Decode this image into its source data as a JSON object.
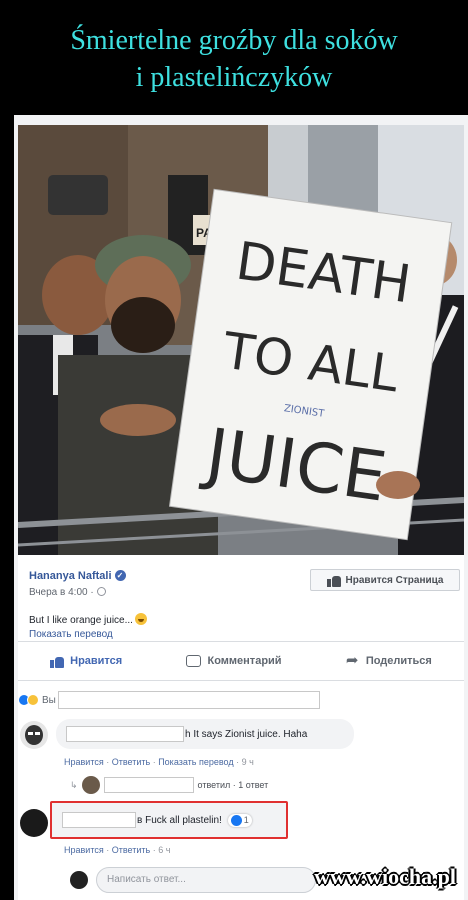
{
  "meme": {
    "title_line1": "Śmiertelne groźby dla soków",
    "title_line2": "i plastelińczyków",
    "watermark": "www.wiocha.pl"
  },
  "photo": {
    "sign_line1": "DEATH",
    "sign_line2": "TO ALL",
    "sign_line3": "JUICE",
    "sign_small": "ZIONIST",
    "bg_sign_fragment": "PAL"
  },
  "post": {
    "author": "Hananya Naftali",
    "time": "Вчера в 4:00 ·",
    "like_page_label": "Нравится Страница",
    "text": "But I like orange juice...",
    "translate": "Показать перевод"
  },
  "actions": {
    "like": "Нравится",
    "comment": "Комментарий",
    "share": "Поделиться"
  },
  "comments": {
    "reactions_text": "Вы",
    "c1_text": "h It says Zionist juice. Haha",
    "c1_meta_like": "Нравится",
    "c1_meta_reply": "Ответить",
    "c1_meta_translate": "Показать перевод",
    "c1_meta_time": "9 ч",
    "reply_summary": "ответил · 1 ответ",
    "c2_text": "в Fuck all plastelin!",
    "c2_likes": "1",
    "c2_meta_like": "Нравится",
    "c2_meta_reply": "Ответить",
    "c2_meta_time": "6 ч",
    "reply_placeholder": "Написать ответ..."
  },
  "colors": {
    "title": "#3ee0e0",
    "fb_blue": "#4267b2",
    "highlight": "#e03030"
  }
}
